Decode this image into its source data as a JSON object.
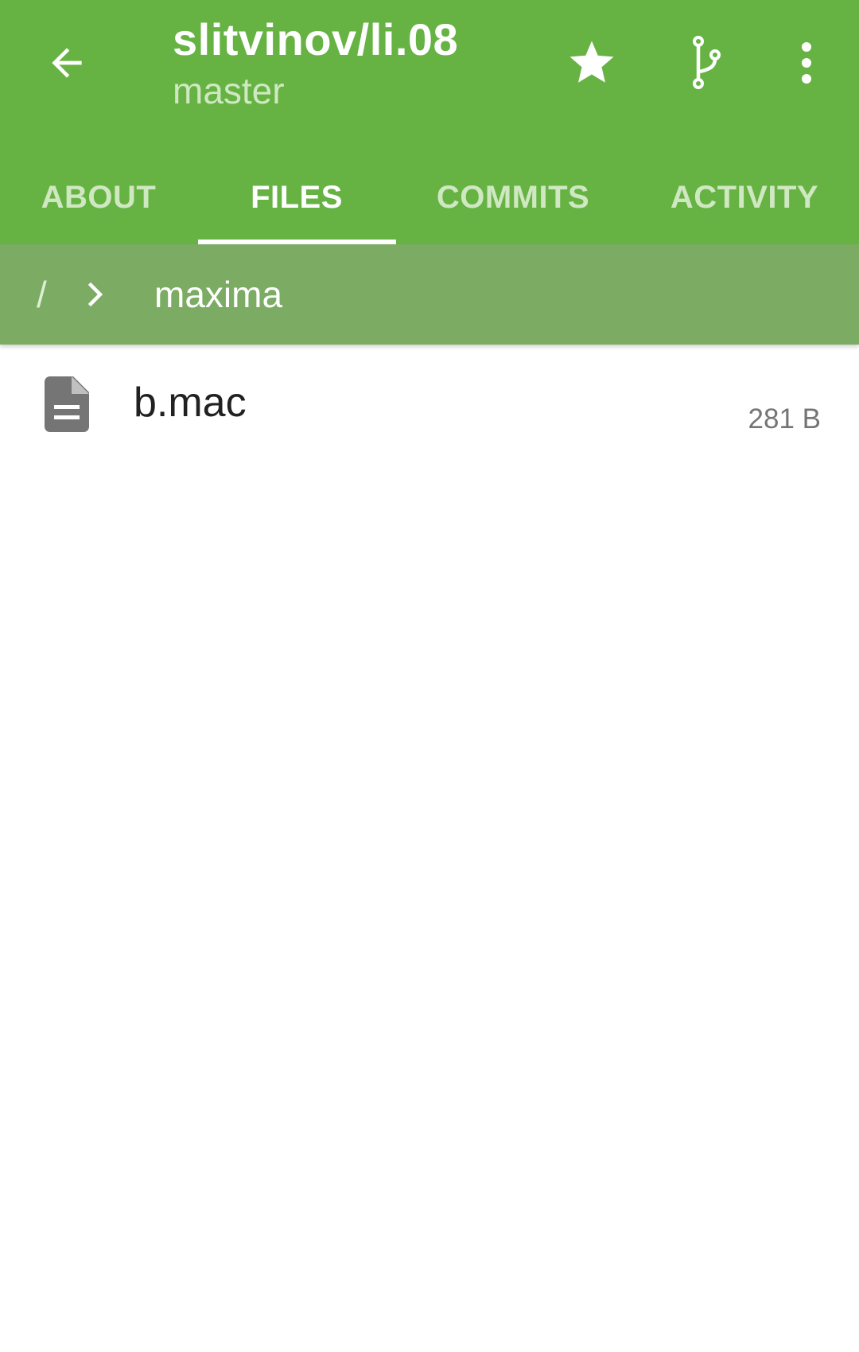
{
  "header": {
    "title": "slitvinov/li.08",
    "subtitle": "master",
    "back_icon": "arrow-left-icon",
    "actions": [
      {
        "name": "star",
        "icon": "star-icon"
      },
      {
        "name": "branch",
        "icon": "branch-icon"
      },
      {
        "name": "more",
        "icon": "more-vert-icon"
      }
    ]
  },
  "tabs": [
    {
      "label": "ABOUT",
      "active": false
    },
    {
      "label": "FILES",
      "active": true
    },
    {
      "label": "COMMITS",
      "active": false
    },
    {
      "label": "ACTIVITY",
      "active": false
    }
  ],
  "breadcrumb": {
    "root": "/",
    "separator_icon": "chevron-right-icon",
    "current": "maxima"
  },
  "files": [
    {
      "name": "b.mac",
      "size": "281 B",
      "icon": "file-icon"
    }
  ],
  "colors": {
    "primary": "#66b344",
    "breadcrumb_bg": "#7cab64",
    "tab_inactive": "#cfe8c1",
    "text_primary": "#212121",
    "text_secondary": "#757575"
  }
}
